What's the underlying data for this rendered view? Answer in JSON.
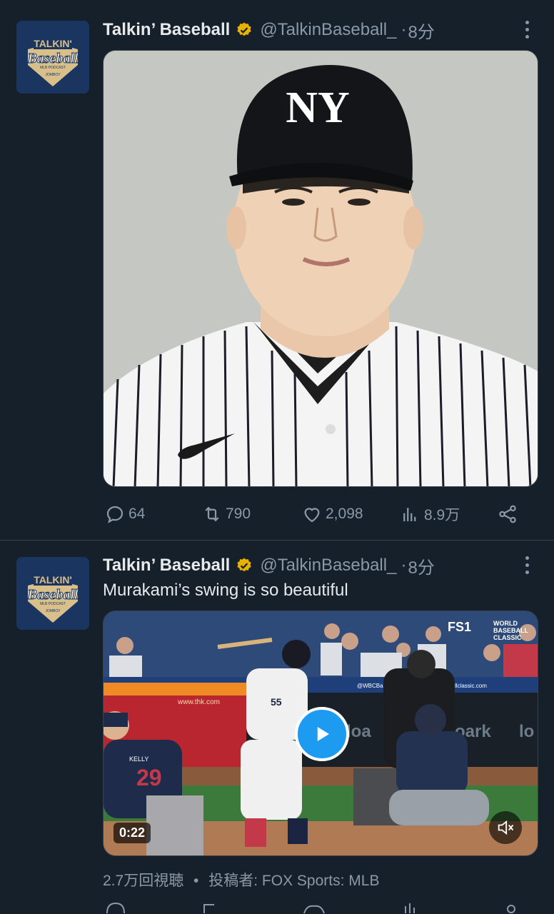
{
  "colors": {
    "background": "#15202b",
    "primary_text": "#e7e9ea",
    "secondary_text": "#8b98a5",
    "accent": "#1d9bf0",
    "verified_badge": "#e8b300"
  },
  "tweets": [
    {
      "author": {
        "display_name": "Talkin’ Baseball",
        "handle": "@TalkinBaseball_",
        "avatar_logo_text": [
          "TALKIN'",
          "Baseball",
          "MLB PODCAST",
          "JOMBOY"
        ]
      },
      "separator": "·",
      "time": "8分",
      "media": {
        "type": "photo",
        "icon": "player-portrait-photo"
      },
      "actions": {
        "replies": "64",
        "retweets": "790",
        "likes": "2,098",
        "views": "8.9万"
      }
    },
    {
      "author": {
        "display_name": "Talkin’ Baseball",
        "handle": "@TalkinBaseball_",
        "avatar_logo_text": [
          "TALKIN'",
          "Baseball",
          "MLB PODCAST",
          "JOMBOY"
        ]
      },
      "separator": "·",
      "time": "8分",
      "text": "Murakami’s swing is so beautiful",
      "media": {
        "type": "video",
        "duration": "0:22",
        "broadcast_logo": "FS1",
        "event_logo": [
          "WORLD",
          "BASEBALL",
          "CLASSIC"
        ],
        "scene_text": [
          "@WBCBaseball",
          "www.thk.com",
          "oark",
          "lo",
          "KELLY",
          "29",
          "55",
          "llclassic.com"
        ]
      },
      "video_meta": {
        "view_count": "2.7万回視聴",
        "bullet": "•",
        "posted_by": "投稿者: FOX Sports: MLB"
      }
    }
  ]
}
